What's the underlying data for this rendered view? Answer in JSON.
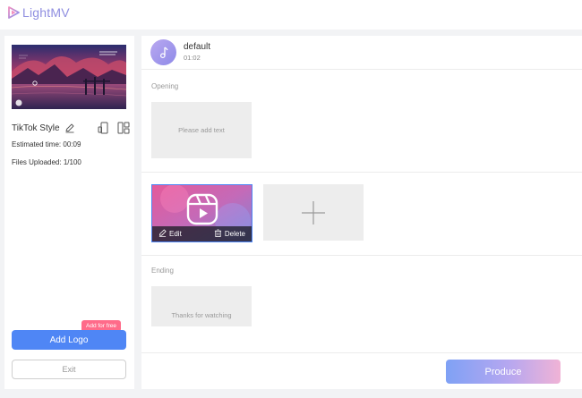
{
  "app": {
    "brand": "LightMV",
    "brand_color": "#8f8ee0"
  },
  "sidebar": {
    "style_name": "TikTok Style",
    "estimated_time_label": "Estimated time:",
    "estimated_time_value": "00:09",
    "files_uploaded_label": "Files Uploaded:",
    "files_uploaded_value": "1/100",
    "badge": "Add for free",
    "add_logo_label": "Add Logo",
    "exit_label": "Exit"
  },
  "music": {
    "title": "default",
    "duration": "01:02"
  },
  "sections": {
    "opening_label": "Opening",
    "opening_placeholder": "Please add text",
    "ending_label": "Ending",
    "ending_text": "Thanks for watching"
  },
  "clip": {
    "edit_label": "Edit",
    "delete_label": "Delete"
  },
  "footer": {
    "produce_label": "Produce"
  },
  "colors": {
    "primary": "#4f86f5",
    "badge": "#ff6b8a",
    "card_bg": "#ededed"
  },
  "icons": {
    "logo": "play-triangle-logo-icon",
    "style_edit": "pencil-icon",
    "portrait": "portrait-phone-icon",
    "layout": "layout-grid-icon",
    "music": "music-note-icon",
    "clip": "reels-play-icon",
    "edit": "pencil-icon",
    "delete": "trash-icon",
    "add": "plus-icon"
  }
}
